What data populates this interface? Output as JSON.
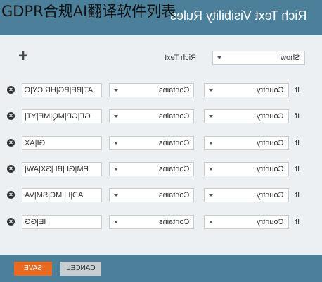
{
  "overlay_text": "GDPR合规AI翻译软件列表",
  "header": {
    "title": "Rich Text Visibility Rules"
  },
  "top": {
    "action_value": "Show",
    "field_label": "Rich Text"
  },
  "rules": [
    {
      "if": "If",
      "field": "Country",
      "op": "Contains",
      "value": "AT|BE|BG|HR|CY|C"
    },
    {
      "if": "If",
      "field": "Country",
      "op": "Contains",
      "value": "GF|GP|MQ|ME|YT|"
    },
    {
      "if": "If",
      "field": "Country",
      "op": "Contains",
      "value": "GI|AX"
    },
    {
      "if": "If",
      "field": "Country",
      "op": "Contains",
      "value": "PM|GL|BL|SX|AW|"
    },
    {
      "if": "If",
      "field": "Country",
      "op": "Contains",
      "value": "AD|LI|MC|SM|VA"
    },
    {
      "if": "If",
      "field": "Country",
      "op": "Contains",
      "value": "IE|GG"
    }
  ],
  "footer": {
    "save_label": "SAVE",
    "cancel_label": "CANCEL"
  },
  "colors": {
    "header": "#4c7f9a",
    "save": "#e8691f",
    "panel": "#ecf0f2"
  }
}
